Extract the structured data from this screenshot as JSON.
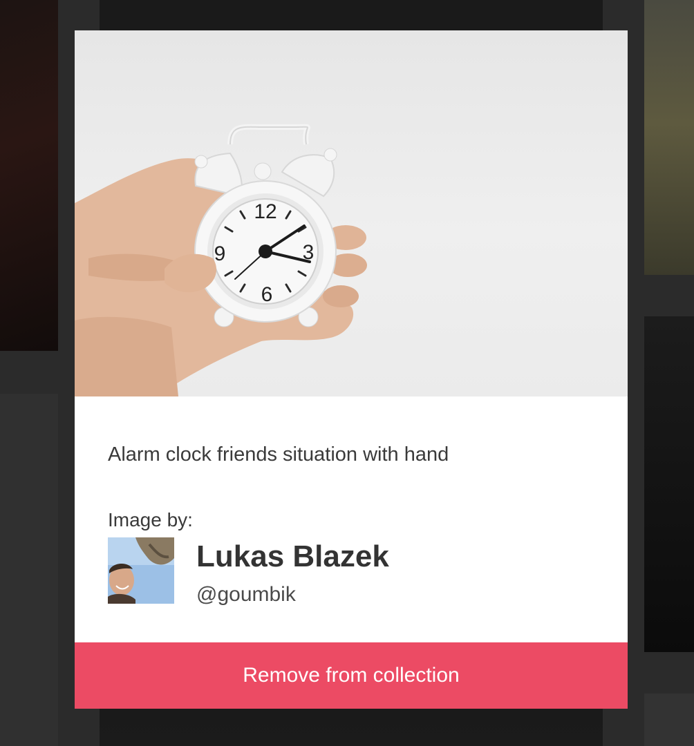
{
  "photo": {
    "icon": "alarm-clock-photo",
    "clock_numerals": [
      "12",
      "3",
      "6",
      "9"
    ]
  },
  "description": "Alarm clock friends situation with hand",
  "credit": {
    "label": "Image by:",
    "author_name": "Lukas Blazek",
    "author_handle": "@goumbik"
  },
  "actions": {
    "remove_label": "Remove from collection"
  },
  "colors": {
    "button": "#ec4b64",
    "overlay": "#2b2b2b",
    "modal": "#ffffff"
  }
}
